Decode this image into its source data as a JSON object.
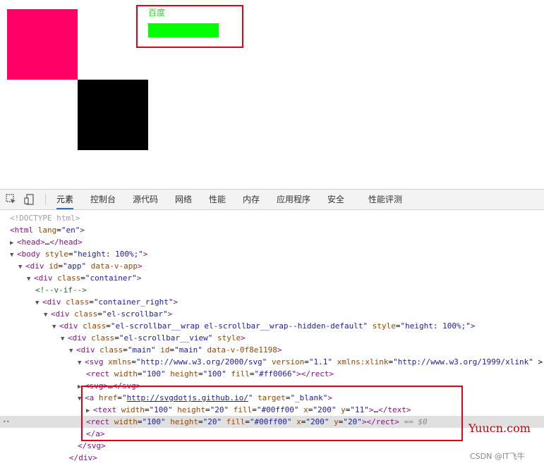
{
  "preview": {
    "pink_rect_color": "#ff0066",
    "black_rect_color": "#000000",
    "link_text": "百度",
    "link_color": "#00ff00",
    "green_bar_color": "#00ff00"
  },
  "devtools": {
    "tabs": [
      "元素",
      "控制台",
      "源代码",
      "网络",
      "性能",
      "内存",
      "应用程序",
      "安全",
      "性能评测"
    ],
    "active_tab": "元素",
    "lines": [
      {
        "indent": 0,
        "tri": "",
        "html": "<span class='gray'>&lt;!DOCTYPE html&gt;</span>"
      },
      {
        "indent": 0,
        "tri": "",
        "html": "<span class='tag'>&lt;html</span> <span class='an'>lang</span>=<span class='av'>\"en\"</span><span class='tag'>&gt;</span>"
      },
      {
        "indent": 0,
        "tri": "▶",
        "html": "<span class='tag'>&lt;head&gt;</span>…<span class='tag'>&lt;/head&gt;</span>"
      },
      {
        "indent": 0,
        "tri": "▼",
        "html": "<span class='tag'>&lt;body</span> <span class='an'>style</span>=<span class='av'>\"height: 100%;\"</span><span class='tag'>&gt;</span>"
      },
      {
        "indent": 1,
        "tri": "▼",
        "html": "<span class='tag'>&lt;div</span> <span class='an'>id</span>=<span class='av'>\"app\"</span> <span class='an'>data-v-app</span><span class='tag'>&gt;</span>"
      },
      {
        "indent": 2,
        "tri": "▼",
        "html": "<span class='tag'>&lt;div</span> <span class='an'>class</span>=<span class='av'>\"container\"</span><span class='tag'>&gt;</span>"
      },
      {
        "indent": 3,
        "tri": "",
        "html": "<span class='cm'>&lt;!--v-if--&gt;</span>"
      },
      {
        "indent": 3,
        "tri": "▼",
        "html": "<span class='tag'>&lt;div</span> <span class='an'>class</span>=<span class='av'>\"container_right\"</span><span class='tag'>&gt;</span>"
      },
      {
        "indent": 4,
        "tri": "▼",
        "html": "<span class='tag'>&lt;div</span> <span class='an'>class</span>=<span class='av'>\"el-scrollbar\"</span><span class='tag'>&gt;</span>"
      },
      {
        "indent": 5,
        "tri": "▼",
        "html": "<span class='tag'>&lt;div</span> <span class='an'>class</span>=<span class='av'>\"el-scrollbar__wrap el-scrollbar__wrap--hidden-default\"</span> <span class='an'>style</span>=<span class='av'>\"height: 100%;\"</span><span class='tag'>&gt;</span>"
      },
      {
        "indent": 6,
        "tri": "▼",
        "html": "<span class='tag'>&lt;div</span> <span class='an'>class</span>=<span class='av'>\"el-scrollbar__view\"</span> <span class='an'>style</span><span class='tag'>&gt;</span>"
      },
      {
        "indent": 7,
        "tri": "▼",
        "html": "<span class='tag'>&lt;div</span> <span class='an'>class</span>=<span class='av'>\"main\"</span> <span class='an'>id</span>=<span class='av'>\"main\"</span> <span class='an'>data-v-0f8e1198</span><span class='tag'>&gt;</span>"
      },
      {
        "indent": 8,
        "tri": "▼",
        "html": "<span class='tag'>&lt;svg</span> <span class='an'>xmlns</span>=<span class='av'>\"http://www.w3.org/2000/svg\"</span> <span class='an'>version</span>=<span class='av'>\"1.1\"</span> <span class='an'>xmlns:xlink</span>=<span class='av'>\"http://www.w3.org/1999/xlink\"</span> &gt;"
      },
      {
        "indent": 9,
        "tri": "",
        "html": "<span class='tag'>&lt;rect</span> <span class='an'>width</span>=<span class='av'>\"100\"</span> <span class='an'>height</span>=<span class='av'>\"100\"</span> <span class='an'>fill</span>=<span class='av'>\"#ff0066\"</span><span class='tag'>&gt;&lt;/rect&gt;</span>"
      },
      {
        "indent": 8,
        "tri": "▶",
        "html": "<span class='tag'>&lt;svg&gt;</span>…<span class='tag'>&lt;/svg&gt;</span>"
      },
      {
        "indent": 8,
        "tri": "▼",
        "html": "<span class='tag'>&lt;a</span> <span class='an'>href</span>=<span class='av'>\"<span class='link'>http://svgdotjs.github.io/</span>\"</span> <span class='an'>target</span>=<span class='av'>\"_blank\"</span><span class='tag'>&gt;</span>"
      },
      {
        "indent": 9,
        "tri": "▶",
        "html": "<span class='tag'>&lt;text</span> <span class='an'>width</span>=<span class='av'>\"100\"</span> <span class='an'>height</span>=<span class='av'>\"20\"</span> <span class='an'>fill</span>=<span class='av'>\"#00ff00\"</span> <span class='an'>x</span>=<span class='av'>\"200\"</span> <span class='an'>y</span>=<span class='av'>\"11\"</span><span class='tag'>&gt;</span>…<span class='tag'>&lt;/text&gt;</span>"
      },
      {
        "indent": 9,
        "tri": "",
        "sel": true,
        "html": "<span class='tag'>&lt;rect</span> <span class='an'>width</span>=<span class='av'>\"100\"</span> <span class='an'>height</span>=<span class='av'>\"20\"</span> <span class='an'>fill</span>=<span class='av'>\"#00ff00\"</span> <span class='an'>x</span>=<span class='av'>\"200\"</span> <span class='an'>y</span>=<span class='av'>\"20\"</span><span class='tag'>&gt;&lt;/rect&gt;</span> <span class='eqsel'>== $0</span>"
      },
      {
        "indent": 9,
        "tri": "",
        "html": "<span class='tag'>&lt;/a&gt;</span>"
      },
      {
        "indent": 8,
        "tri": "",
        "html": "<span class='tag'>&lt;/svg&gt;</span>"
      },
      {
        "indent": 7,
        "tri": "",
        "html": "<span class='tag'>&lt;/div&gt;</span>"
      }
    ]
  },
  "watermark": {
    "yuucn": "Yuucn.com",
    "csdn": "CSDN @IT飞牛"
  }
}
